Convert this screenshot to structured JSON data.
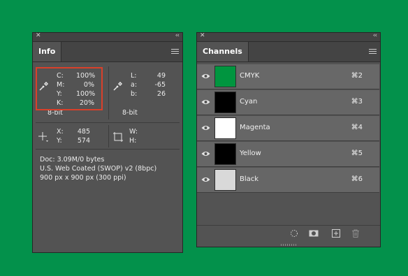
{
  "info_panel": {
    "tab_label": "Info",
    "cmyk": {
      "c_label": "C:",
      "c_value": "100%",
      "m_label": "M:",
      "m_value": "0%",
      "y_label": "Y:",
      "y_value": "100%",
      "k_label": "K:",
      "k_value": "20%",
      "bit_depth": "8-bit"
    },
    "lab": {
      "l_label": "L:",
      "l_value": "49",
      "a_label": "a:",
      "a_value": "-65",
      "b_label": "b:",
      "b_value": "26",
      "bit_depth": "8-bit"
    },
    "position": {
      "x_label": "X:",
      "x_value": "485",
      "y_label": "Y:",
      "y_value": "574"
    },
    "size": {
      "w_label": "W:",
      "h_label": "H:"
    },
    "doc_lines": [
      "Doc: 3.09M/0 bytes",
      "U.S. Web Coated (SWOP) v2 (8bpc)",
      "900 px x 900 px (300 ppi)"
    ]
  },
  "channels_panel": {
    "tab_label": "Channels",
    "channels": [
      {
        "name": "CMYK",
        "shortcut": "⌘2",
        "thumb_color": "#00953f",
        "selected": true
      },
      {
        "name": "Cyan",
        "shortcut": "⌘3",
        "thumb_color": "#000000"
      },
      {
        "name": "Magenta",
        "shortcut": "⌘4",
        "thumb_color": "#ffffff"
      },
      {
        "name": "Yellow",
        "shortcut": "⌘5",
        "thumb_color": "#000000"
      },
      {
        "name": "Black",
        "shortcut": "⌘6",
        "thumb_color": "#d9d9d9"
      }
    ],
    "footer_icons": [
      "load-selection-icon",
      "save-selection-mask-icon",
      "new-channel-icon",
      "trash-icon"
    ]
  },
  "colors": {
    "background": "#03914b",
    "highlight_box": "#d9402a"
  }
}
